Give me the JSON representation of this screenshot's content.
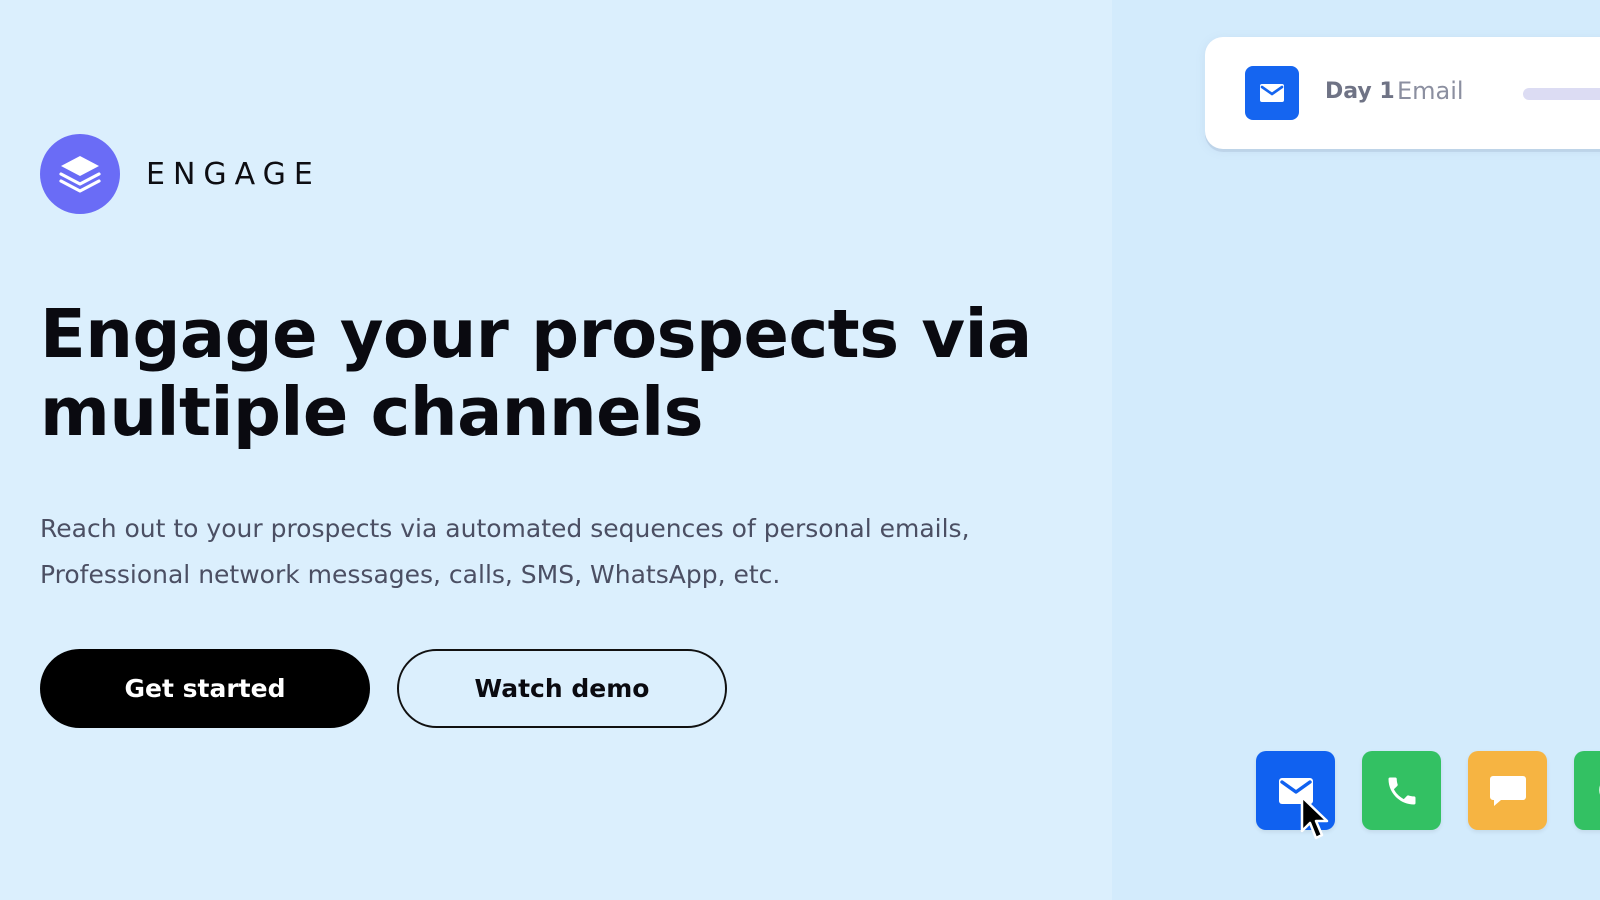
{
  "brand": {
    "name": "ENGAGE",
    "logo_icon": "layers-icon",
    "accent_color": "#6a6cf6"
  },
  "hero": {
    "headline": "Engage your prospects via multiple channels",
    "subtext": "Reach out to your prospects via automated sequences of personal emails, Professional network messages, calls, SMS, WhatsApp, etc."
  },
  "buttons": {
    "primary_label": "Get started",
    "secondary_label": "Watch demo"
  },
  "sequence_card": {
    "day_label": "Day 1",
    "type_label": "Email",
    "icon": "envelope-icon",
    "icon_color": "#1565f0"
  },
  "channels": [
    {
      "name": "email",
      "icon": "envelope-icon",
      "color": "#1061f0"
    },
    {
      "name": "call",
      "icon": "phone-icon",
      "color": "#33c163"
    },
    {
      "name": "sms",
      "icon": "chat-bubble-icon",
      "color": "#f6b442"
    },
    {
      "name": "whatsapp",
      "icon": "whatsapp-icon",
      "color": "#33c163"
    }
  ]
}
